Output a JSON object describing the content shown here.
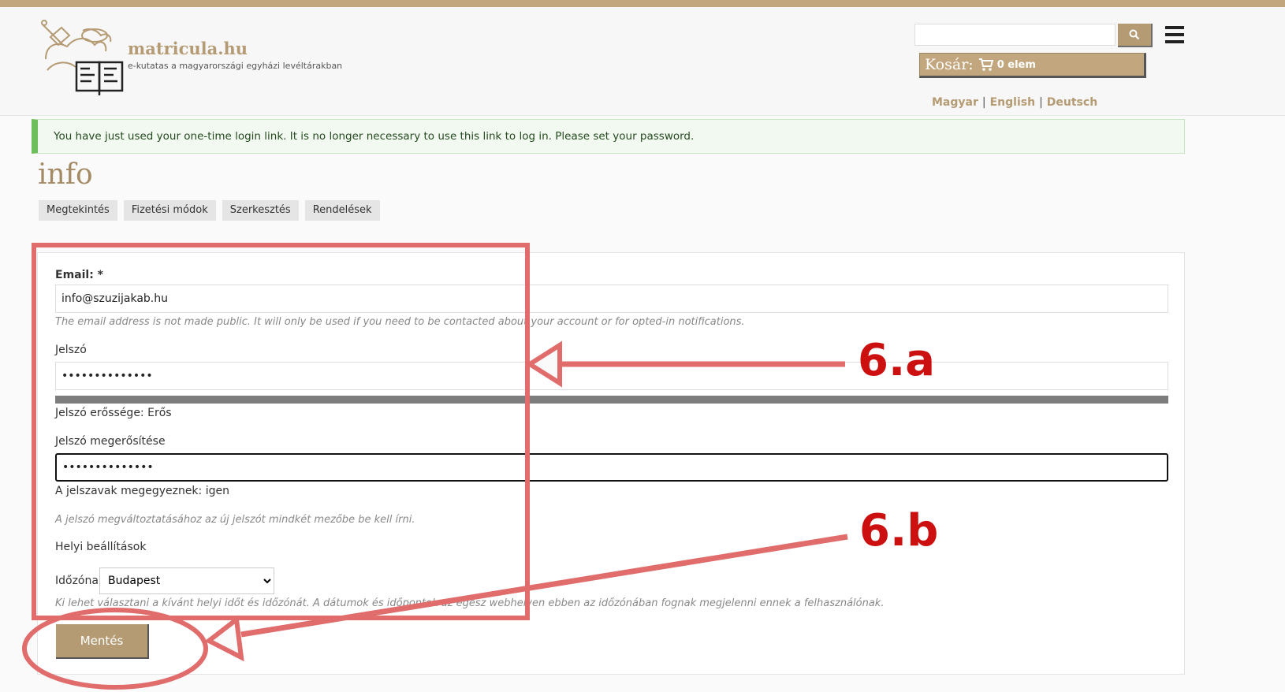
{
  "header": {
    "site_name": "matricula.hu",
    "site_slogan": "e-kutatas a magyarországi egyházi levéltárakban",
    "search_placeholder": "",
    "cart_label": "Kosár:",
    "cart_count": "0 elem",
    "languages": [
      "Magyar",
      "English",
      "Deutsch"
    ]
  },
  "message": "You have just used your one-time login link. It is no longer necessary to use this link to log in. Please set your password.",
  "page_title": "info",
  "tabs": [
    "Megtekintés",
    "Fizetési módok",
    "Szerkesztés",
    "Rendelések"
  ],
  "form": {
    "email_label": "Email: *",
    "email_value": "info@szuzijakab.hu",
    "email_desc": "The email address is not made public. It will only be used if you need to be contacted about your account or for opted-in notifications.",
    "password_label": "Jelszó",
    "password_value": "••••••••••••••",
    "strength_text": "Jelszó erőssége: Erős",
    "confirm_label": "Jelszó megerősítése",
    "confirm_value": "••••••••••••••",
    "match_text": "A jelszavak megegyeznek: igen",
    "password_desc": "A jelszó megváltoztatásához az új jelszót mindkét mezőbe be kell írni.",
    "locale_heading": "Helyi beállítások",
    "timezone_label": "Időzóna",
    "timezone_value": "Budapest",
    "timezone_desc": "Ki lehet választani a kívánt helyi időt és időzónát. A dátumok és időpontok az egész webhelyen ebben az időzónában fognak megjelenni ennek a felhasználónak.",
    "save_label": "Mentés"
  },
  "annotations": {
    "label_a": "6.a",
    "label_b": "6.b",
    "color": "#cc1010"
  }
}
